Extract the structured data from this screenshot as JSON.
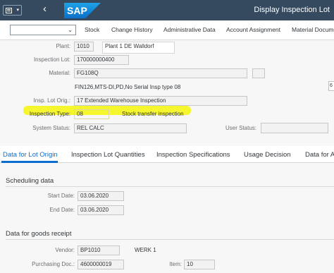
{
  "shell": {
    "logo": "SAP",
    "title": "Display Inspection Lot"
  },
  "toolbar": {
    "buttons": [
      "Stock",
      "Change History",
      "Administrative Data",
      "Account Assignment",
      "Material Document"
    ]
  },
  "form": {
    "plant": {
      "label": "Plant:",
      "value": "1010",
      "description": "Plant 1 DE Walldorf"
    },
    "inspection_lot": {
      "label": "Inspection Lot:",
      "value": "170000000400"
    },
    "material": {
      "label": "Material:",
      "value": "FG108Q",
      "description": "FIN126,MTS-DI,PD,No Serial Insp type 08"
    },
    "insp_lot_origin": {
      "label": "Insp. Lot Orig.:",
      "value": "17 Extended Warehouse Inspection"
    },
    "inspection_type": {
      "label": "Inspection Type:",
      "value": "08",
      "description": "Stock transfer inspection"
    },
    "system_status": {
      "label": "System Status:",
      "value": "REL   CALC"
    },
    "user_status": {
      "label": "User Status:",
      "value": ""
    },
    "side_button": "6"
  },
  "highlight_color": "#f5f51d",
  "tabs": [
    {
      "label": "Data for Lot Origin",
      "active": true
    },
    {
      "label": "Inspection Lot Quantities",
      "active": false
    },
    {
      "label": "Inspection Specifications",
      "active": false
    },
    {
      "label": "Usage Decision",
      "active": false
    },
    {
      "label": "Data for A",
      "active": false
    }
  ],
  "scheduling": {
    "title": "Scheduling data",
    "start_date_label": "Start Date:",
    "start_date": "03.06.2020",
    "end_date_label": "End Date:",
    "end_date": "03.06.2020"
  },
  "goods_receipt": {
    "title": "Data for goods receipt",
    "vendor_label": "Vendor:",
    "vendor": "BP1010",
    "vendor_desc": "WERK 1",
    "purchasing_doc_label": "Purchasing Doc.:",
    "purchasing_doc": "4600000019",
    "item_label": "Item:",
    "item": "10"
  }
}
